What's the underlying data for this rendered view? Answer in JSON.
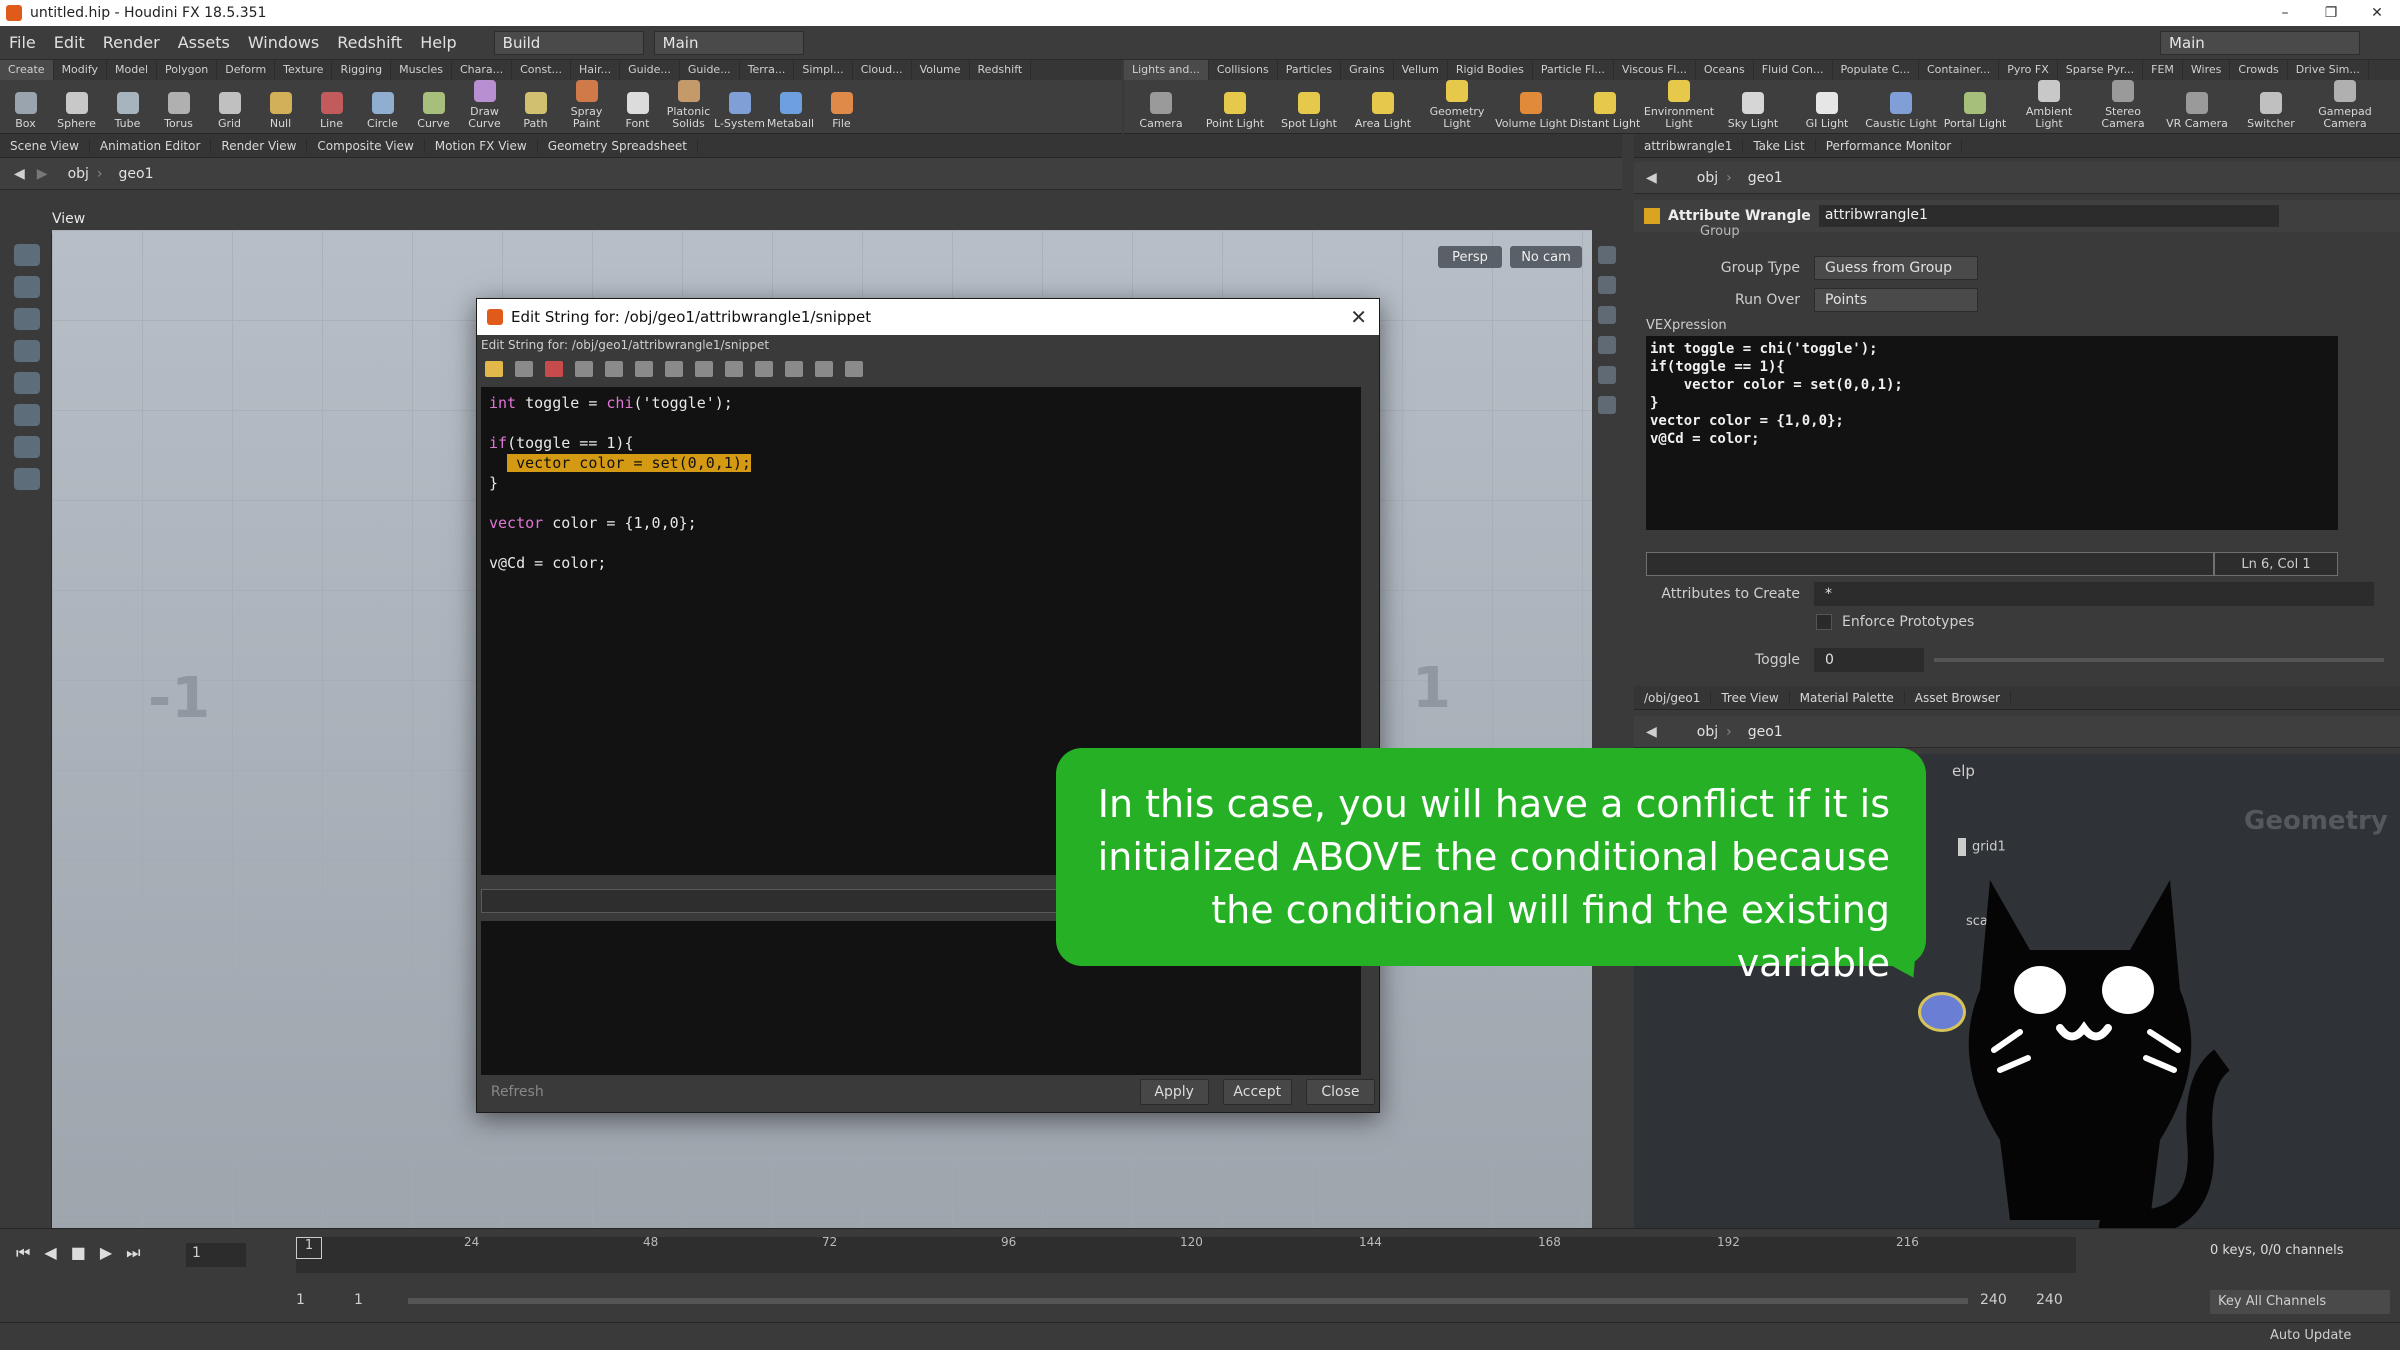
{
  "window": {
    "title": "untitled.hip - Houdini FX 18.5.351",
    "controls": [
      "–",
      "❐",
      "✕"
    ]
  },
  "menu": {
    "items": [
      "File",
      "Edit",
      "Render",
      "Assets",
      "Windows",
      "Redshift",
      "Help"
    ],
    "desktop": "Build",
    "context": "Main",
    "right_desktop": "Main"
  },
  "shelf_left": {
    "tabs": [
      "Create",
      "Modify",
      "Model",
      "Polygon",
      "Deform",
      "Texture",
      "Rigging",
      "Muscles",
      "Chara...",
      "Const...",
      "Hair...",
      "Guide...",
      "Guide...",
      "Terra...",
      "Simpl...",
      "Cloud...",
      "Volume",
      "Redshift"
    ],
    "tools": [
      "Box",
      "Sphere",
      "Tube",
      "Torus",
      "Grid",
      "Null",
      "Line",
      "Circle",
      "Curve",
      "Draw Curve",
      "Path",
      "Spray Paint",
      "Font",
      "Platonic Solids",
      "L-System",
      "Metaball",
      "File"
    ]
  },
  "shelf_right": {
    "tabs": [
      "Lights and...",
      "Collisions",
      "Particles",
      "Grains",
      "Vellum",
      "Rigid Bodies",
      "Particle Fl...",
      "Viscous Fl...",
      "Oceans",
      "Fluid Con...",
      "Populate C...",
      "Container...",
      "Pyro FX",
      "Sparse Pyr...",
      "FEM",
      "Wires",
      "Crowds",
      "Drive Sim..."
    ],
    "tools": [
      "Camera",
      "Point Light",
      "Spot Light",
      "Area Light",
      "Geometry Light",
      "Volume Light",
      "Distant Light",
      "Environment Light",
      "Sky Light",
      "GI Light",
      "Caustic Light",
      "Portal Light",
      "Ambient Light",
      "Stereo Camera",
      "VR Camera",
      "Switcher",
      "Gamepad Camera"
    ]
  },
  "left_pane": {
    "tabs": [
      "Scene View",
      "Animation Editor",
      "Render View",
      "Composite View",
      "Motion FX View",
      "Geometry Spreadsheet"
    ],
    "path": [
      "obj",
      "geo1"
    ],
    "view_label": "View",
    "persp": "Persp",
    "cam": "No cam",
    "axis_left": "-1",
    "axis_right": "1"
  },
  "dialog": {
    "title": "Edit String for: /obj/geo1/attribwrangle1/snippet",
    "subtitle": "Edit String for: /obj/geo1/attribwrangle1/snippet",
    "code": {
      "l1a": "int",
      "l1b": " toggle = ",
      "l1c": "chi",
      "l1d": "('toggle');",
      "l3a": "if",
      "l3b": "(toggle == 1){",
      "l4": "vector color = set(0,0,1);",
      "l5": "}",
      "l7a": "vector",
      "l7b": " color = {1,0,0};",
      "l9": "v@Cd = color;"
    },
    "buttons": {
      "refresh": "Refresh",
      "apply": "Apply",
      "accept": "Accept",
      "close": "Close"
    }
  },
  "right_top": {
    "tabs": [
      "attribwrangle1",
      "Take List",
      "Performance Monitor"
    ],
    "path": [
      "obj",
      "geo1"
    ],
    "node_type": "Attribute Wrangle",
    "node_name": "attribwrangle1",
    "group_label": "Group",
    "group_type_label": "Group Type",
    "group_type_value": "Guess from Group",
    "run_over_label": "Run Over",
    "run_over_value": "Points",
    "vex_label": "VEXpression",
    "vex_lines": [
      "int toggle = chi('toggle');",
      "",
      "if(toggle == 1){",
      "    vector color = set(0,0,1);",
      "}",
      "",
      "vector color = {1,0,0};",
      "",
      "v@Cd = color;"
    ],
    "cursor_pos": "Ln 6, Col 1",
    "attrs_label": "Attributes to Create",
    "attrs_value": "*",
    "enforce_label": "Enforce Prototypes",
    "toggle_label": "Toggle",
    "toggle_value": "0"
  },
  "right_bottom": {
    "tabs": [
      "/obj/geo1",
      "Tree View",
      "Material Palette",
      "Asset Browser"
    ],
    "path": [
      "obj",
      "geo1"
    ],
    "help": "elp",
    "context_label": "Geometry",
    "nodes": [
      "grid1",
      "scatte"
    ]
  },
  "timeline": {
    "frame": "1",
    "ticks": [
      "24",
      "48",
      "72",
      "96",
      "120",
      "144",
      "168",
      "192",
      "216"
    ],
    "start": "1",
    "start2": "1",
    "end": "240",
    "end2": "240",
    "keys": "0 keys, 0/0 channels",
    "key_all": "Key All Channels",
    "auto_update": "Auto Update"
  },
  "overlay": {
    "text_lines": [
      "In this case, you will have a conflict if it is",
      "initialized ABOVE the conditional because",
      "the conditional will find the existing variable"
    ]
  },
  "colors": {
    "bubble": "#25b025",
    "highlight": "#d59a14",
    "keyword": "#e077d6"
  }
}
